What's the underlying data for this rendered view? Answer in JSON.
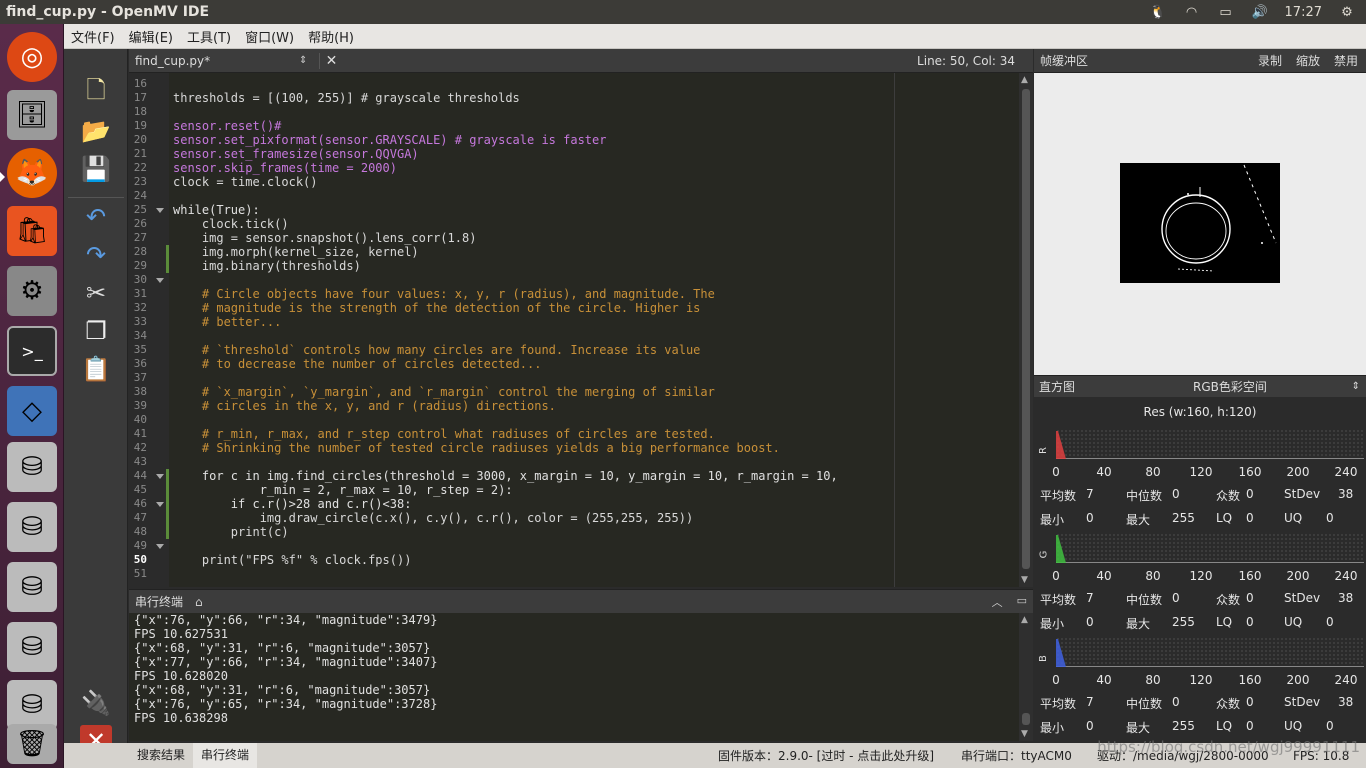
{
  "window_title": "find_cup.py - OpenMV IDE",
  "tray": {
    "time": "17:27"
  },
  "menu": [
    "文件(F)",
    "编辑(E)",
    "工具(T)",
    "窗口(W)",
    "帮助(H)"
  ],
  "editor": {
    "filename": "find_cup.py*",
    "cursor_pos": "Line: 50, Col: 34",
    "lines": [
      {
        "n": "16",
        "t": ""
      },
      {
        "n": "17",
        "t": "thresholds = [(100, 255)] # grayscale thresholds"
      },
      {
        "n": "18",
        "t": ""
      },
      {
        "n": "19",
        "t": "sensor.reset()#"
      },
      {
        "n": "20",
        "t": "sensor.set_pixformat(sensor.GRAYSCALE) # grayscale is faster"
      },
      {
        "n": "21",
        "t": "sensor.set_framesize(sensor.QQVGA)"
      },
      {
        "n": "22",
        "t": "sensor.skip_frames(time = 2000)"
      },
      {
        "n": "23",
        "t": "clock = time.clock()"
      },
      {
        "n": "24",
        "t": ""
      },
      {
        "n": "25",
        "t": "while(True):"
      },
      {
        "n": "26",
        "t": "    clock.tick()"
      },
      {
        "n": "27",
        "t": "    img = sensor.snapshot().lens_corr(1.8)"
      },
      {
        "n": "28",
        "t": "    img.morph(kernel_size, kernel)"
      },
      {
        "n": "29",
        "t": "    img.binary(thresholds)"
      },
      {
        "n": "30",
        "t": ""
      },
      {
        "n": "31",
        "t": "    # Circle objects have four values: x, y, r (radius), and magnitude. The"
      },
      {
        "n": "32",
        "t": "    # magnitude is the strength of the detection of the circle. Higher is"
      },
      {
        "n": "33",
        "t": "    # better..."
      },
      {
        "n": "34",
        "t": ""
      },
      {
        "n": "35",
        "t": "    # `threshold` controls how many circles are found. Increase its value"
      },
      {
        "n": "36",
        "t": "    # to decrease the number of circles detected..."
      },
      {
        "n": "37",
        "t": ""
      },
      {
        "n": "38",
        "t": "    # `x_margin`, `y_margin`, and `r_margin` control the merging of similar"
      },
      {
        "n": "39",
        "t": "    # circles in the x, y, and r (radius) directions."
      },
      {
        "n": "40",
        "t": ""
      },
      {
        "n": "41",
        "t": "    # r_min, r_max, and r_step control what radiuses of circles are tested."
      },
      {
        "n": "42",
        "t": "    # Shrinking the number of tested circle radiuses yields a big performance boost."
      },
      {
        "n": "43",
        "t": ""
      },
      {
        "n": "44",
        "t": "    for c in img.find_circles(threshold = 3000, x_margin = 10, y_margin = 10, r_margin = 10,"
      },
      {
        "n": "45",
        "t": "            r_min = 2, r_max = 10, r_step = 2):"
      },
      {
        "n": "46",
        "t": "        if c.r()>28 and c.r()<38:"
      },
      {
        "n": "47",
        "t": "            img.draw_circle(c.x(), c.y(), c.r(), color = (255,255, 255))"
      },
      {
        "n": "48",
        "t": "        print(c)"
      },
      {
        "n": "49",
        "t": ""
      },
      {
        "n": "50",
        "t": "    print(\"FPS %f\" % clock.fps())"
      },
      {
        "n": "51",
        "t": ""
      }
    ]
  },
  "terminal": {
    "title": "串行终端",
    "lines": [
      "{\"x\":76, \"y\":66, \"r\":34, \"magnitude\":3479}",
      "FPS 10.627531",
      "{\"x\":68, \"y\":31, \"r\":6, \"magnitude\":3057}",
      "{\"x\":77, \"y\":66, \"r\":34, \"magnitude\":3407}",
      "FPS 10.628020",
      "{\"x\":68, \"y\":31, \"r\":6, \"magnitude\":3057}",
      "{\"x\":76, \"y\":65, \"r\":34, \"magnitude\":3728}",
      "FPS 10.638298"
    ]
  },
  "framebuffer": {
    "title": "帧缓冲区",
    "buttons": [
      "录制",
      "缩放",
      "禁用"
    ]
  },
  "histogram": {
    "title": "直方图",
    "colorspace": "RGB色彩空间",
    "resolution": "Res (w:160, h:120)",
    "ticks": [
      "0",
      "40",
      "80",
      "120",
      "160",
      "200",
      "240"
    ],
    "labels": {
      "mean": "平均数",
      "median": "中位数",
      "mode": "众数",
      "stdev": "StDev",
      "min": "最小",
      "max": "最大",
      "lq": "LQ",
      "uq": "UQ"
    },
    "channels": [
      {
        "name": "R",
        "color": "#e04040",
        "mean": "7",
        "median": "0",
        "mode": "0",
        "stdev": "38",
        "min": "0",
        "max": "255",
        "lq": "0",
        "uq": "0"
      },
      {
        "name": "G",
        "color": "#40c040",
        "mean": "7",
        "median": "0",
        "mode": "0",
        "stdev": "38",
        "min": "0",
        "max": "255",
        "lq": "0",
        "uq": "0"
      },
      {
        "name": "B",
        "color": "#4060e0",
        "mean": "7",
        "median": "0",
        "mode": "0",
        "stdev": "38",
        "min": "0",
        "max": "255",
        "lq": "0",
        "uq": "0"
      }
    ]
  },
  "status": {
    "tabs": [
      "搜索结果",
      "串行终端"
    ],
    "firmware": "固件版本：2.9.0- [过时 - 点击此处升级]",
    "port": "串行端口：ttyACM0",
    "drive": "驱动：/media/wgj/2800-0000",
    "fps": "FPS:   10.8"
  },
  "watermark": "https://blog.csdn.net/wgj99991111"
}
